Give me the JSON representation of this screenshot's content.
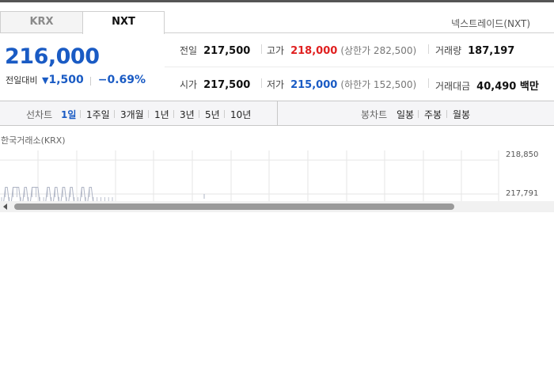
{
  "tabs": [
    {
      "label": "KRX",
      "active": false
    },
    {
      "label": "NXT",
      "active": true
    }
  ],
  "provider": "넥스트레이드(NXT)",
  "price": {
    "current": "216,000",
    "change_label": "전일대비",
    "change_value": "1,500",
    "change_pct": "−0.69%",
    "direction": "down"
  },
  "stats": {
    "prev_close": {
      "label": "전일",
      "value": "217,500"
    },
    "high": {
      "label": "고가",
      "value": "218,000",
      "upper_limit": "(상한가 282,500)"
    },
    "volume": {
      "label": "거래량",
      "value": "187,197"
    },
    "open": {
      "label": "시가",
      "value": "217,500"
    },
    "low": {
      "label": "저가",
      "value": "215,000",
      "lower_limit": "(하한가 152,500)"
    },
    "amount": {
      "label": "거래대금",
      "value": "40,490 백만"
    }
  },
  "line_chart_periods": {
    "caption": "선차트",
    "items": [
      "1일",
      "1주일",
      "3개월",
      "1년",
      "3년",
      "5년",
      "10년"
    ],
    "active": "1일"
  },
  "candle_chart_periods": {
    "caption": "봉차트",
    "items": [
      "일봉",
      "주봉",
      "월봉"
    ]
  },
  "chart": {
    "source_label": "한국거래소(KRX)",
    "y_labels": [
      "218,850",
      "217,791"
    ]
  },
  "chart_data": {
    "type": "line",
    "title": "",
    "xlabel": "",
    "ylabel": "",
    "ylim": [
      217400,
      219000
    ],
    "y_ticks": [
      218850,
      217791
    ],
    "x": [
      0,
      1,
      2,
      3,
      4,
      5,
      6,
      7,
      8,
      9,
      10,
      11,
      12,
      13,
      14,
      15,
      16,
      17,
      18,
      19,
      20,
      21,
      22,
      23,
      24,
      25,
      26,
      27,
      28,
      29
    ],
    "values": [
      217500,
      218000,
      217500,
      218000,
      218000,
      217500,
      218000,
      217500,
      218000,
      218000,
      217500,
      217500,
      218000,
      217500,
      218000,
      217500,
      218000,
      217500,
      218000,
      217500,
      217500,
      218000,
      217500,
      218000,
      217500,
      217500,
      217500,
      217500,
      217500,
      217500
    ],
    "grid": true,
    "colors": {
      "line": "#aeb4c4",
      "grid": "#e6e6e6"
    }
  },
  "colors": {
    "accent_blue": "#1a5bc4",
    "up_red": "#e02020"
  }
}
